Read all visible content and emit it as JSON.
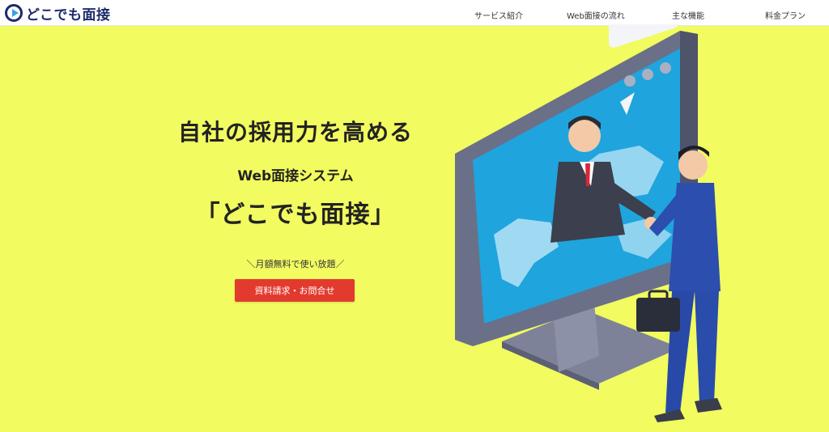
{
  "header": {
    "logo_text": "どこでも面接",
    "nav": [
      "サービス紹介",
      "Web面接の流れ",
      "主な機能",
      "料金プラン"
    ]
  },
  "hero": {
    "headline": "自社の採用力を高める",
    "subhead": "Web面接システム",
    "product_name": "「どこでも面接」",
    "tagline": "＼月額無料で使い放題／",
    "cta_label": "資料請求・お問合せ"
  },
  "colors": {
    "background": "#f2fb5f",
    "cta": "#e23a2f",
    "brand": "#1d2a6b"
  }
}
